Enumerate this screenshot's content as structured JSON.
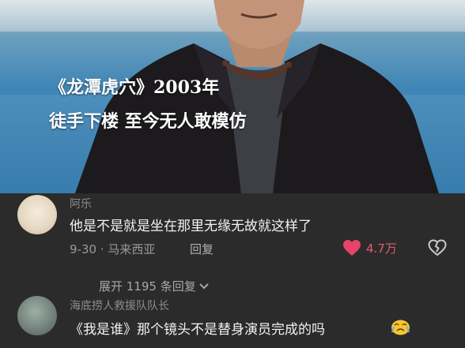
{
  "video": {
    "caption_line1": "《龙潭虎穴》2003年",
    "caption_line2": "徒手下楼 至今无人敢模仿"
  },
  "comments": [
    {
      "username": "阿乐",
      "text": "他是不是就是坐在那里无缘无故就这样了",
      "meta": "9-30 · 马来西亚",
      "reply_label": "回复",
      "likes": "4.7万",
      "expand_label": "展开 1195 条回复"
    },
    {
      "username": "海底捞人救援队队长",
      "text": "《我是谁》那个镜头不是替身演员完成的吗"
    }
  ],
  "colors": {
    "background": "#2b2b2b",
    "like_accent": "#e35b6e",
    "muted_text": "#8d8d8d"
  },
  "icons": [
    "heart-icon",
    "broken-heart-icon",
    "chevron-down-icon",
    "crying-emoji-icon"
  ]
}
